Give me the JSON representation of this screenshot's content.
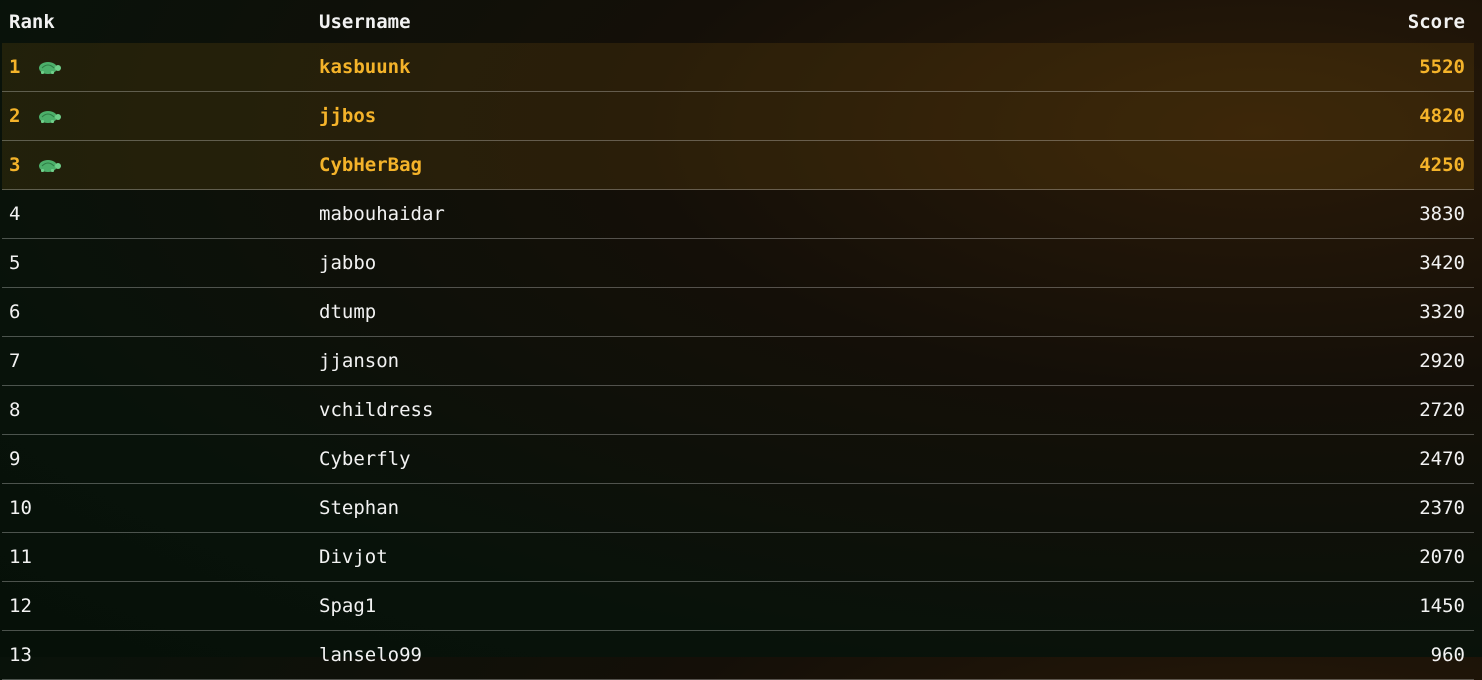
{
  "header": {
    "rank": "Rank",
    "username": "Username",
    "score": "Score"
  },
  "rows": [
    {
      "rank": "1",
      "username": "kasbuunk",
      "score": "5520",
      "badge": "turtle-icon"
    },
    {
      "rank": "2",
      "username": "jjbos",
      "score": "4820",
      "badge": "turtle-icon"
    },
    {
      "rank": "3",
      "username": "CybHerBag",
      "score": "4250",
      "badge": "turtle-icon"
    },
    {
      "rank": "4",
      "username": "mabouhaidar",
      "score": "3830"
    },
    {
      "rank": "5",
      "username": "jabbo",
      "score": "3420"
    },
    {
      "rank": "6",
      "username": "dtump",
      "score": "3320"
    },
    {
      "rank": "7",
      "username": "jjanson",
      "score": "2920"
    },
    {
      "rank": "8",
      "username": "vchildress",
      "score": "2720"
    },
    {
      "rank": "9",
      "username": "Cyberfly",
      "score": "2470"
    },
    {
      "rank": "10",
      "username": "Stephan",
      "score": "2370"
    },
    {
      "rank": "11",
      "username": "Divjot",
      "score": "2070"
    },
    {
      "rank": "12",
      "username": "Spag1",
      "score": "1450"
    },
    {
      "rank": "13",
      "username": "lanselo99",
      "score": "960"
    }
  ],
  "colors": {
    "highlight_text": "#f4b32a",
    "normal_text": "#f2f2f2",
    "turtle_shell": "#4caf6a"
  }
}
